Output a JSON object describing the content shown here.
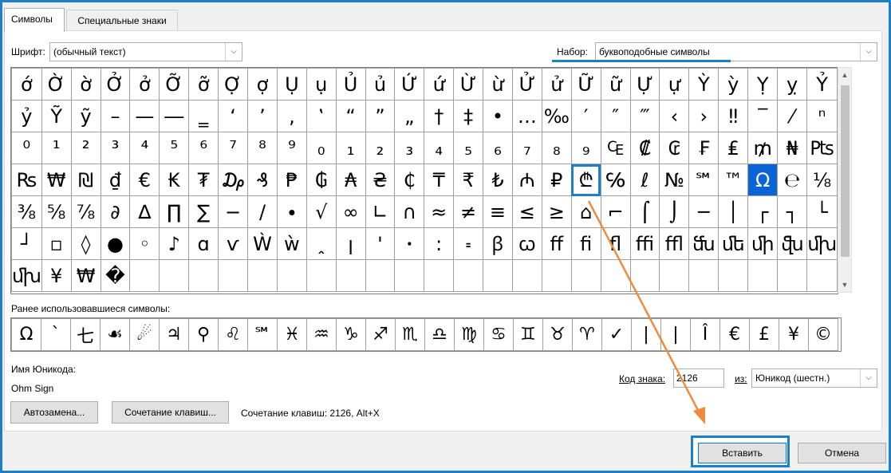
{
  "tabs": [
    "Символы",
    "Специальные знаки"
  ],
  "font": {
    "label": "Шрифт:",
    "value": "(обычный текст)"
  },
  "subset": {
    "label": "Набор:",
    "value": "буквоподобные символы"
  },
  "grid_rows": [
    [
      "ớ",
      "Ờ",
      "ờ",
      "Ở",
      "ở",
      "Ỡ",
      "ỡ",
      "Ợ",
      "ợ",
      "Ụ",
      "ụ",
      "Ủ",
      "ủ",
      "Ứ",
      "ứ",
      "Ừ",
      "ừ",
      "Ử",
      "ử",
      "Ữ",
      "ữ",
      "Ự",
      "ự",
      "Ỳ",
      "ỳ",
      "Ỵ",
      "ỵ",
      "Ỷ"
    ],
    [
      "ỷ",
      "Ỹ",
      "ỹ",
      "–",
      "—",
      "―",
      "‗",
      "‘",
      "’",
      "‚",
      "‛",
      "“",
      "”",
      "„",
      "†",
      "‡",
      "•",
      "…",
      "‰",
      "′",
      "″",
      "‴",
      "‹",
      "›",
      "‼",
      "‾",
      "⁄",
      "ⁿ"
    ],
    [
      "⁰",
      "¹",
      "²",
      "³",
      "⁴",
      "⁵",
      "⁶",
      "⁷",
      "⁸",
      "⁹",
      "₀",
      "₁",
      "₂",
      "₃",
      "₄",
      "₅",
      "₆",
      "₇",
      "₈",
      "₉",
      "₠",
      "₡",
      "₢",
      "₣",
      "₤",
      "₥",
      "₦",
      "₧"
    ],
    [
      "₨",
      "₩",
      "₪",
      "₫",
      "€",
      "₭",
      "₮",
      "₯",
      "₰",
      "₱",
      "₲",
      "₳",
      "₴",
      "₵",
      "₸",
      "₹",
      "₺",
      "₼",
      "₽",
      "₾",
      "℅",
      "ℓ",
      "№",
      "℠",
      "™",
      "Ω",
      "℮",
      "⅛"
    ],
    [
      "⅜",
      "⅝",
      "⅞",
      "∂",
      "∆",
      "∏",
      "∑",
      "−",
      "∕",
      "∙",
      "√",
      "∞",
      "∟",
      "∩",
      "≈",
      "≠",
      "≡",
      "≤",
      "≥",
      "⌂",
      "⌐",
      "⌠",
      "⌡",
      "─",
      "│",
      "┌",
      "┐",
      "└"
    ],
    [
      "┘",
      "▫",
      "◊",
      "●",
      "◦",
      "♪",
      "ɑ",
      "ѵ",
      "Ẁ",
      "ẁ",
      "ꞈ",
      "ꞁ",
      "ꞌ",
      "ꞏ",
      "꞉",
      "꞊",
      "ꞵ",
      "ꞷ",
      "ﬀ",
      "ﬁ",
      "ﬂ",
      "ﬃ",
      "ﬄ",
      "ﬓ",
      "ﬔ",
      "ﬕ",
      "ﬖ",
      "ﬗ"
    ],
    [
      "ﬗ",
      "¥",
      "₩",
      "�",
      "",
      "",
      "",
      "",
      "",
      "",
      "",
      "",
      "",
      "",
      "",
      "",
      "",
      "",
      "",
      "",
      "",
      "",
      "",
      "",
      "",
      "",
      "",
      ""
    ]
  ],
  "recent_label": "Ранее использовавшиеся символы:",
  "recent": [
    "Ω",
    "`",
    "七",
    "☙",
    "☄",
    "♃",
    "⚲",
    "♌",
    "℠",
    "♓",
    "♒",
    "♑",
    "♐",
    "♏",
    "♎",
    "♍",
    "♋",
    "♊",
    "♉",
    "♈",
    "✓",
    "|",
    "|",
    "Î",
    "€",
    "£",
    "¥",
    "©"
  ],
  "unicode_name_label": "Имя Юникода:",
  "unicode_name": "Ohm Sign",
  "char_code_label": "Код знака:",
  "char_code": "2126",
  "from_label": "из:",
  "from_value": "Юникод (шестн.)",
  "autocorrect_button": "Автозамена...",
  "shortcut_button": "Сочетание клавиш...",
  "shortcut_text": "Сочетание клавиш: 2126, Alt+X",
  "insert_button": "Вставить",
  "cancel_button": "Отмена",
  "colors": {
    "accent": "#1d7fc7",
    "selection": "#0a64d6",
    "arrow": "#f08a3c"
  }
}
